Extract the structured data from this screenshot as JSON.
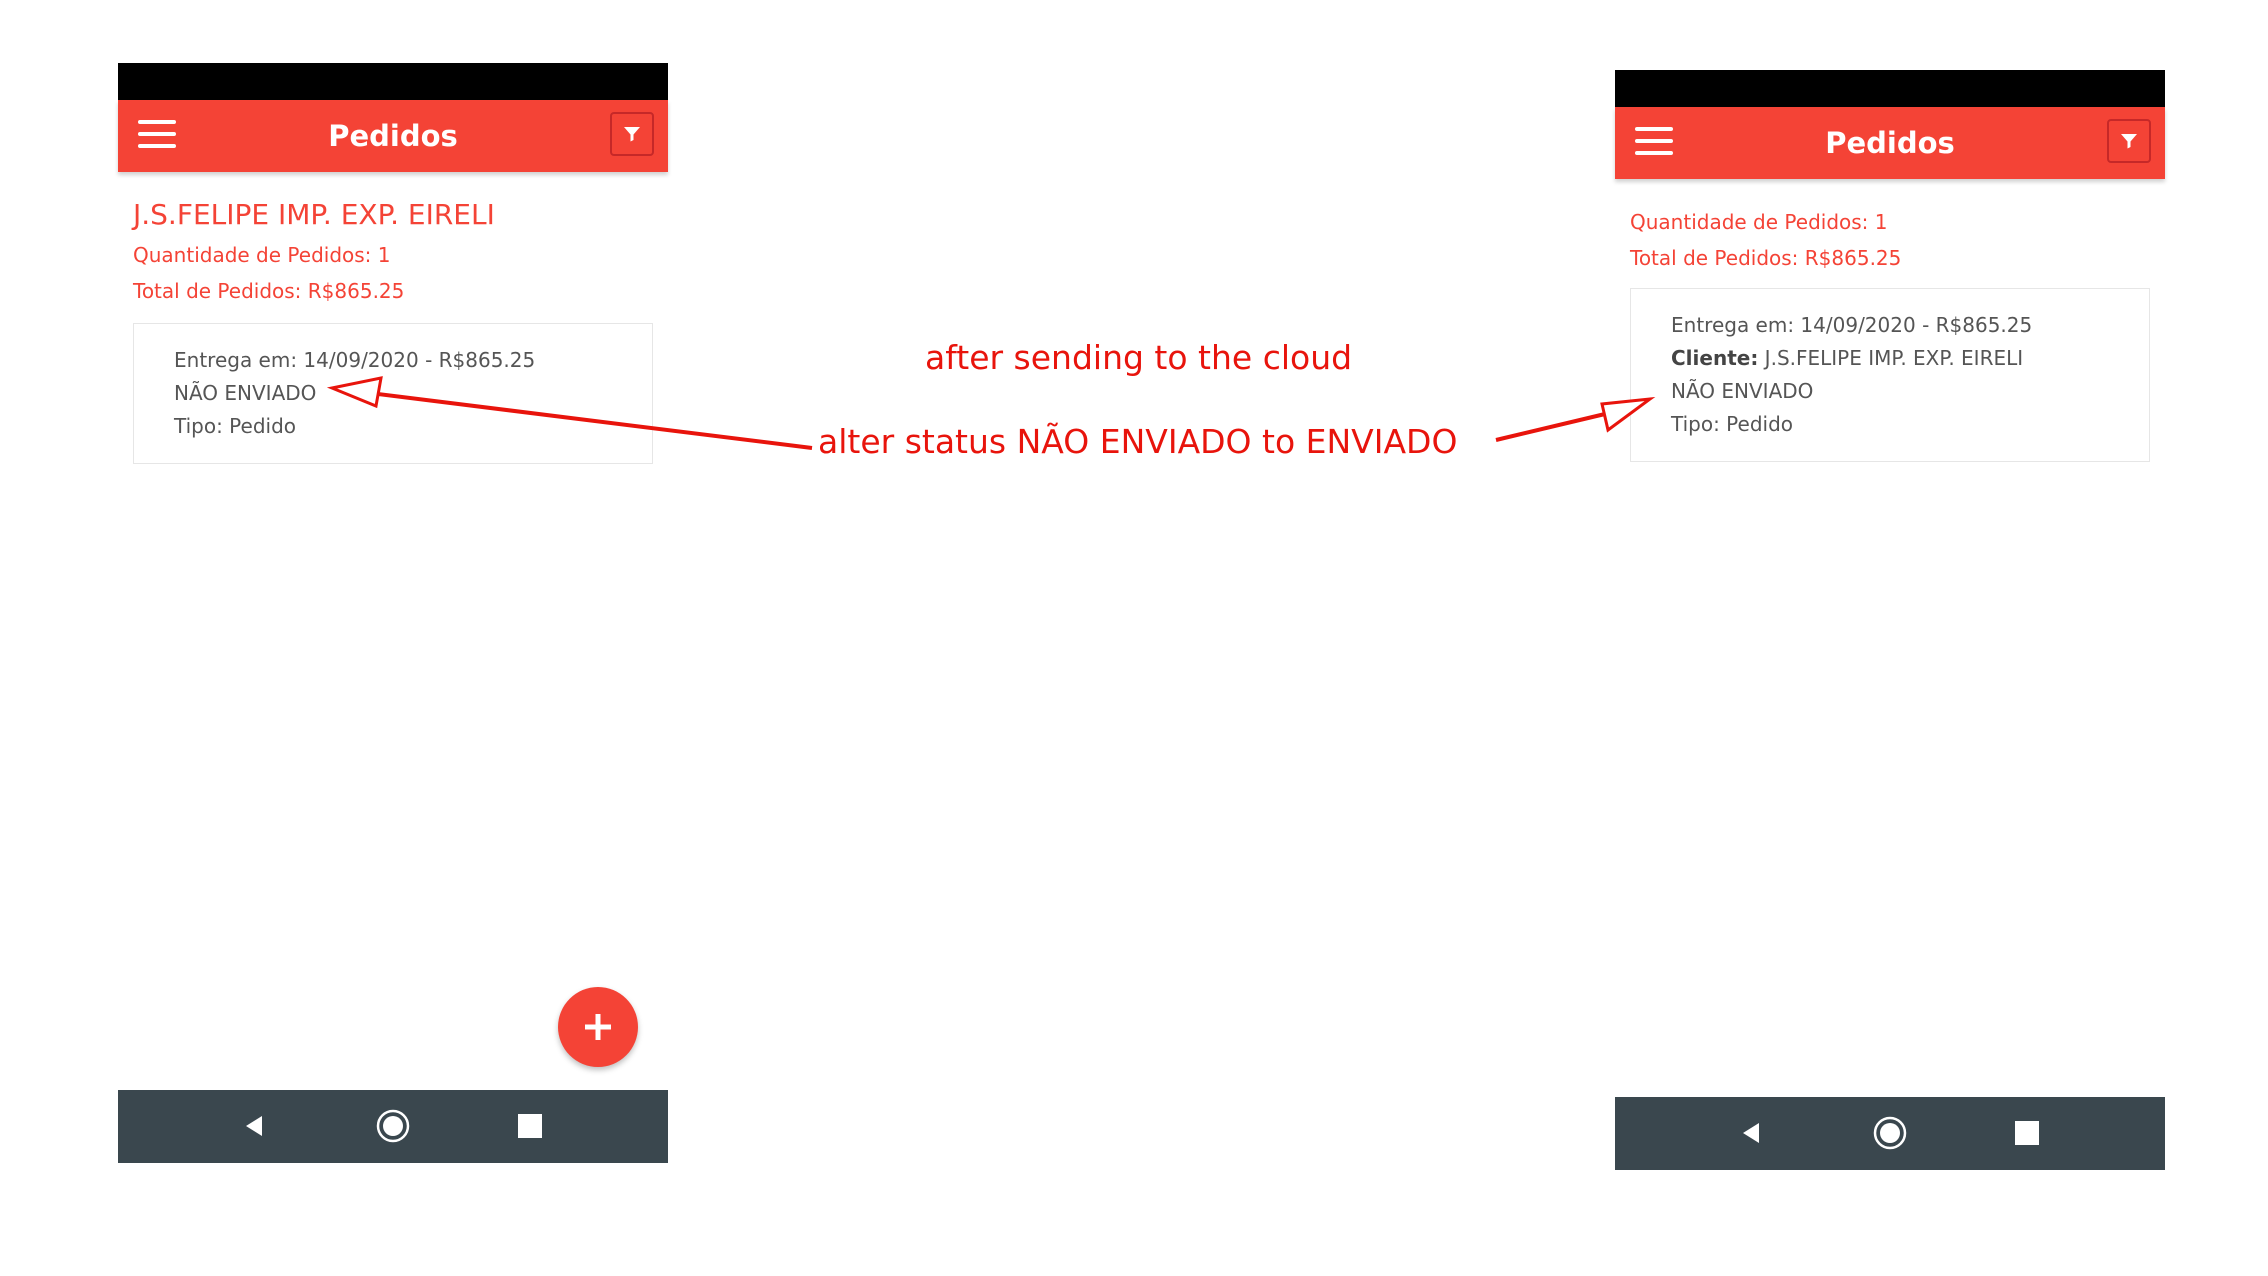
{
  "left_screen": {
    "appbar": {
      "title": "Pedidos"
    },
    "company_name": "J.S.FELIPE IMP. EXP. EIRELI",
    "summary": {
      "quantity": "Quantidade de Pedidos: 1",
      "total": "Total de Pedidos: R$865.25"
    },
    "order_card": {
      "delivery": "Entrega em: 14/09/2020 - R$865.25",
      "status": "NÃO ENVIADO",
      "type": "Tipo: Pedido"
    },
    "fab": {
      "icon": "plus-icon"
    }
  },
  "right_screen": {
    "appbar": {
      "title": "Pedidos"
    },
    "summary": {
      "quantity": "Quantidade de Pedidos: 1",
      "total": "Total de Pedidos: R$865.25"
    },
    "order_card": {
      "delivery": "Entrega em: 14/09/2020 - R$865.25",
      "client_label": "Cliente:",
      "client_value": " J.S.FELIPE IMP. EXP. EIRELI",
      "status": "NÃO ENVIADO",
      "type": "Tipo: Pedido"
    }
  },
  "annotations": {
    "top": "after sending to the cloud",
    "middle": "alter status NÃO ENVIADO to ENVIADO"
  },
  "colors": {
    "accent": "#f44336",
    "status_bar": "#000000",
    "nav_bar": "#3a474e",
    "annotation": "#e8140c"
  },
  "icons": [
    "menu-icon",
    "filter-icon",
    "plus-icon",
    "back-icon",
    "home-icon",
    "recents-icon"
  ]
}
